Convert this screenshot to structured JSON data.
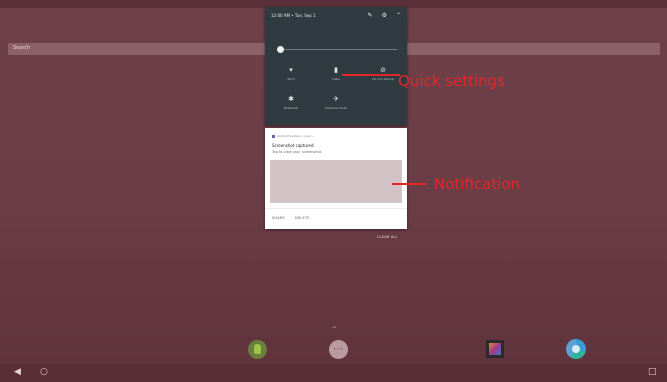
{
  "search": {
    "placeholder": "Search"
  },
  "quick_settings": {
    "time": "12:00 AM • Tue, Sep 1",
    "header_icons": {
      "edit": "✎",
      "settings": "⚙",
      "collapse": "⌃"
    },
    "tiles": [
      {
        "label": "Wi-Fi",
        "icon": "▾",
        "icon_name": "wifi-icon"
      },
      {
        "label": "Data",
        "icon": "▮",
        "icon_name": "battery-icon"
      },
      {
        "label": "Do not disturb",
        "icon": "⊘",
        "icon_name": "dnd-icon"
      },
      {
        "label": "Bluetooth",
        "icon": "✱",
        "icon_name": "bluetooth-icon"
      },
      {
        "label": "Airplane mode",
        "icon": "✈",
        "icon_name": "airplane-icon"
      }
    ]
  },
  "notification": {
    "app": "Android System • now ⌄",
    "title": "Screenshot captured.",
    "text": "Tap to view your screenshot.",
    "actions": {
      "share": "SHARE",
      "delete": "DELETE"
    }
  },
  "clear_all": "CLEAR ALL",
  "annotations": {
    "quick_settings": "Quick settings",
    "notification": "Notification",
    "color": "#e4262b"
  },
  "dock": {
    "handle": "^",
    "apps": [
      "android-app-icon",
      "app-drawer-icon",
      "gallery-app-icon",
      "browser-app-icon"
    ]
  },
  "navbar": {
    "back": "◀",
    "home": "○",
    "recents": "□"
  }
}
